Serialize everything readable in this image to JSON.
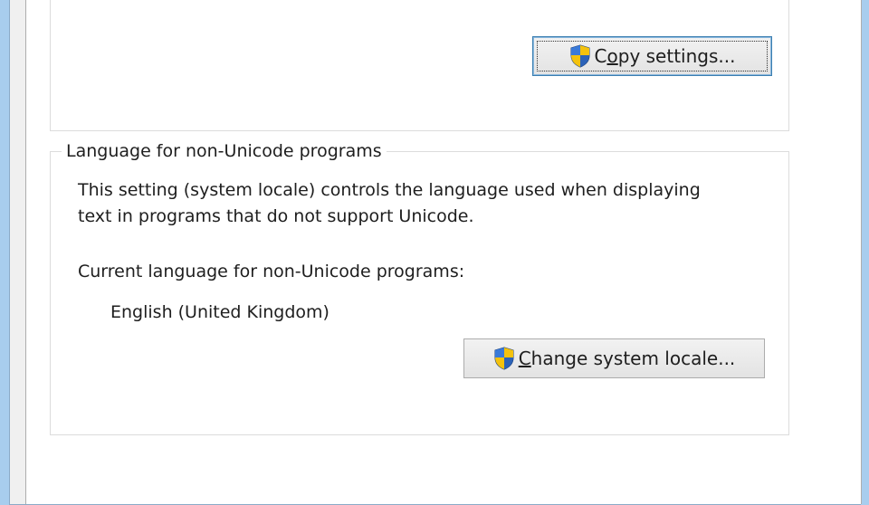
{
  "copy_section": {
    "copy_button_prefix": "C",
    "copy_button_accel": "o",
    "copy_button_rest": "py settings..."
  },
  "non_unicode_group": {
    "legend": "Language for non-Unicode programs",
    "description_line1": "This setting (system locale) controls the language used when displaying",
    "description_line2": "text in programs that do not support Unicode.",
    "current_label": "Current language for non-Unicode programs:",
    "current_value": "English (United Kingdom)",
    "change_button_accel": "C",
    "change_button_rest": "hange system locale..."
  },
  "icons": {
    "uac_shield": "uac-shield-icon"
  }
}
